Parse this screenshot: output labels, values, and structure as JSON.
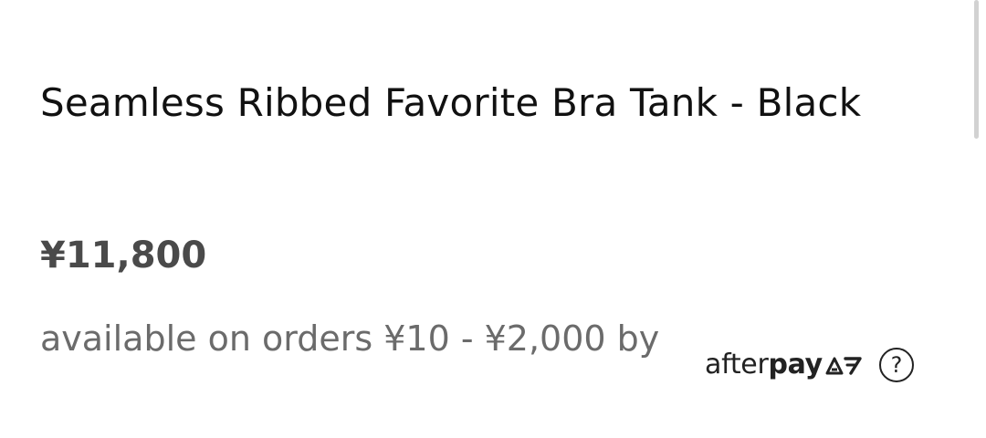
{
  "product": {
    "title": "Seamless Ribbed Favorite Bra Tank - Black",
    "price": "¥11,800"
  },
  "installments": {
    "text": "available on orders ¥10 - ¥2,000 by",
    "provider": {
      "name_part1": "after",
      "name_part2": "pay",
      "logo_icon": "afterpay-arrows-icon",
      "info_label": "?",
      "info_icon": "question-circle-icon"
    }
  },
  "colors": {
    "title": "#111111",
    "price": "#4a4a4a",
    "body_text": "#6b6b6b",
    "background": "#ffffff"
  }
}
